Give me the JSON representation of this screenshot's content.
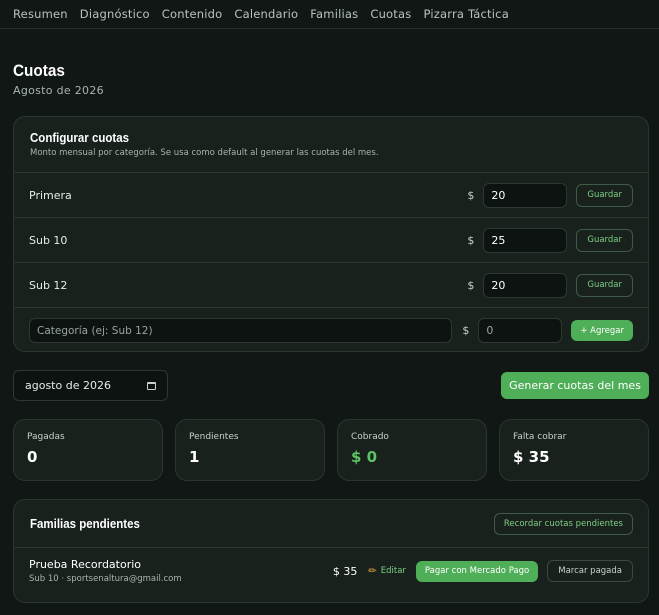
{
  "nav": {
    "items": [
      "Resumen",
      "Diagnóstico",
      "Contenido",
      "Calendario",
      "Familias",
      "Cuotas",
      "Pizarra Táctica"
    ]
  },
  "header": {
    "title": "Cuotas",
    "subtitle": "Agosto de 2026"
  },
  "config": {
    "title": "Configurar cuotas",
    "description": "Monto mensual por categoría. Se usa como default al generar las cuotas del mes.",
    "currency_symbol": "$",
    "save_label": "Guardar",
    "categories": [
      {
        "name": "Primera",
        "amount": "20"
      },
      {
        "name": "Sub 10",
        "amount": "25"
      },
      {
        "name": "Sub 12",
        "amount": "20"
      }
    ],
    "new_category": {
      "placeholder": "Categoría (ej: Sub 12)",
      "amount_placeholder": "0",
      "add_label": "+ Agregar"
    }
  },
  "controls": {
    "month_value": "agosto de 2026",
    "generate_label": "Generar cuotas del mes"
  },
  "stats": [
    {
      "label": "Pagadas",
      "value": "0"
    },
    {
      "label": "Pendientes",
      "value": "1"
    },
    {
      "label": "Cobrado",
      "value": "$ 0"
    },
    {
      "label": "Falta cobrar",
      "value": "$ 35"
    }
  ],
  "pending": {
    "title": "Familias pendientes",
    "remind_label": "Recordar cuotas pendientes",
    "families": [
      {
        "name": "Prueba Recordatorio",
        "meta": "Sub 10 · sportsenaltura@gmail.com",
        "amount": "$ 35",
        "edit_label": "Editar",
        "pay_label": "Pagar con Mercado Pago",
        "mark_label": "Marcar pagada"
      }
    ]
  },
  "colors": {
    "background": "#111714",
    "card": "#19211d",
    "accent": "#4fae58",
    "accent_text": "#7fcf85"
  }
}
